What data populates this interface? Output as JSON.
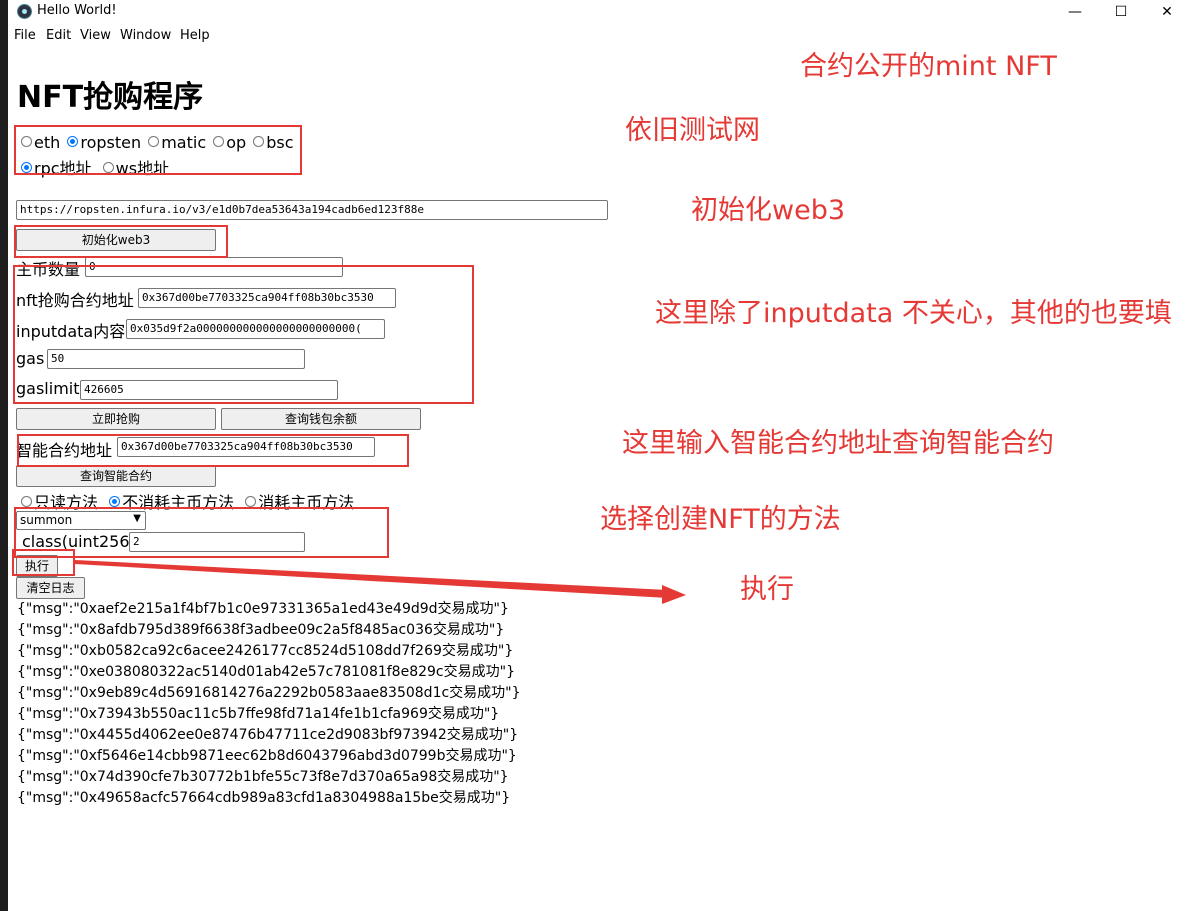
{
  "window": {
    "title": "Hello World!",
    "controls": {
      "minimize": "—",
      "maximize": "☐",
      "close": "✕"
    }
  },
  "menu": [
    "File",
    "Edit",
    "View",
    "Window",
    "Help"
  ],
  "page": {
    "title": "NFT抢购程序",
    "networks": [
      {
        "label": "eth",
        "selected": false
      },
      {
        "label": "ropsten",
        "selected": true
      },
      {
        "label": "matic",
        "selected": false
      },
      {
        "label": "op",
        "selected": false
      },
      {
        "label": "bsc",
        "selected": false
      }
    ],
    "connection_types": [
      {
        "label": "rpc地址",
        "selected": true
      },
      {
        "label": "ws地址",
        "selected": false
      }
    ],
    "rpc_url": "https://ropsten.infura.io/v3/e1d0b7dea53643a194cadb6ed123f88e",
    "init_button": "初始化web3",
    "fields": {
      "coin_amount_label": "主币数量",
      "coin_amount": "0",
      "contract_label": "nft抢购合约地址",
      "contract_value": "0x367d00be7703325ca904ff08b30bc3530",
      "inputdata_label": "inputdata内容",
      "inputdata_value": "0x035d9f2a000000000000000000000000(",
      "gas_label": "gas",
      "gas_value": "50",
      "gaslimit_label": "gaslimit",
      "gaslimit_value": "426605"
    },
    "buy_button": "立即抢购",
    "balance_button": "查询钱包余额",
    "smart_contract_label": "智能合约地址",
    "smart_contract_value": "0x367d00be7703325ca904ff08b30bc3530",
    "query_contract_button": "查询智能合约",
    "method_types": [
      {
        "label": "只读方法",
        "selected": false
      },
      {
        "label": "不消耗主币方法",
        "selected": true
      },
      {
        "label": "消耗主币方法",
        "selected": false
      }
    ],
    "method_select": "summon",
    "param_label": "class(uint256)",
    "param_value": "2",
    "execute_button": "执行",
    "clear_log_button": "清空日志",
    "log": [
      "{\"msg\":\"0xaef2e215a1f4bf7b1c0e97331365a1ed43e49d9d交易成功\"}",
      "{\"msg\":\"0x8afdb795d389f6638f3adbee09c2a5f8485ac036交易成功\"}",
      "{\"msg\":\"0xb0582ca92c6acee2426177cc8524d5108dd7f269交易成功\"}",
      "{\"msg\":\"0xe038080322ac5140d01ab42e57c781081f8e829c交易成功\"}",
      "{\"msg\":\"0x9eb89c4d56916814276a2292b0583aae83508d1c交易成功\"}",
      "{\"msg\":\"0x73943b550ac11c5b7ffe98fd71a14fe1b1cfa969交易成功\"}",
      "{\"msg\":\"0x4455d4062ee0e87476b47711ce2d9083bf973942交易成功\"}",
      "{\"msg\":\"0xf5646e14cbb9871eec62b8d6043796abd3d0799b交易成功\"}",
      "{\"msg\":\"0x74d390cfe7b30772b1bfe55c73f8e7d370a65a98交易成功\"}",
      "{\"msg\":\"0x49658acfc57664cdb989a83cfd1a8304988a15be交易成功\"}"
    ]
  },
  "annotations": {
    "color": "#e53935",
    "mint_note": "合约公开的mint NFT",
    "testnet_note": "依旧测试网",
    "init_note": "初始化web3",
    "fields_note": "这里除了inputdata 不关心，其他的也要填",
    "contract_note": "这里输入智能合约地址查询智能合约",
    "method_note": "选择创建NFT的方法",
    "execute_note": "执行"
  }
}
